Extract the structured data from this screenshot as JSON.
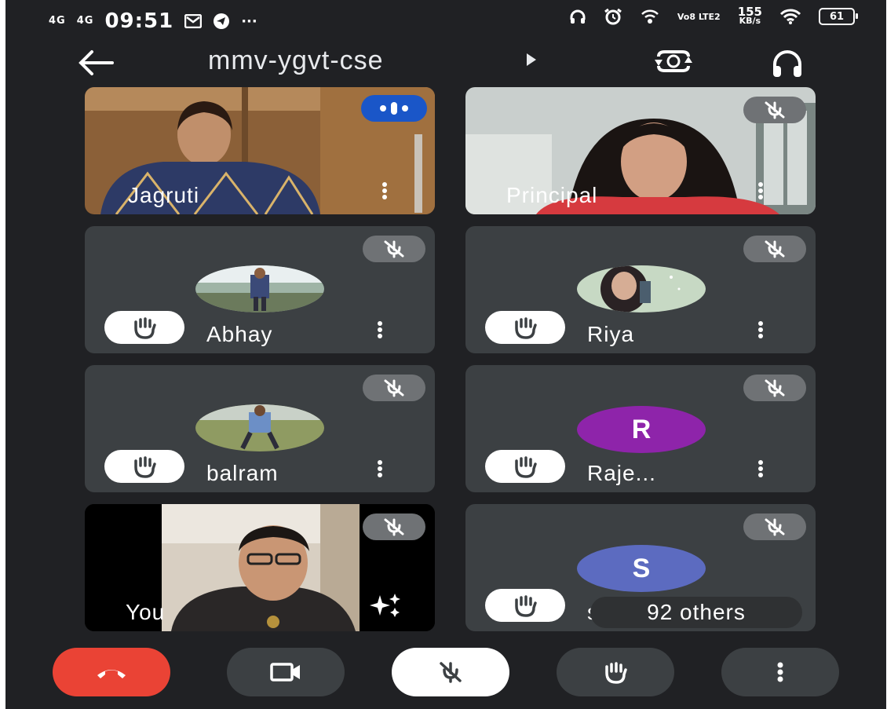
{
  "status_bar": {
    "network1": "4G",
    "network2": "4G",
    "time": "09:51",
    "more": "···",
    "volte": "Vo8 LTE2",
    "speed_value": "155",
    "speed_unit": "KB/s",
    "battery": "61"
  },
  "header": {
    "meeting_code": "mmv-ygvt-cse"
  },
  "participants": [
    {
      "name": "Jagruti",
      "speaking": true,
      "video": true
    },
    {
      "name": "Principal",
      "muted": true,
      "video": true
    },
    {
      "name": "Abhay",
      "muted": true,
      "hand_raised": true
    },
    {
      "name": "Riya",
      "muted": true,
      "hand_raised": true
    },
    {
      "name": "balram",
      "muted": true,
      "hand_raised": true
    },
    {
      "name": "Raje...",
      "muted": true,
      "hand_raised": true,
      "avatar_letter": "R",
      "avatar_color": "#8e24aa"
    },
    {
      "name": "You",
      "muted": true,
      "video": true
    },
    {
      "name": "su",
      "muted": true,
      "hand_raised": true,
      "avatar_letter": "S",
      "avatar_color": "#5c6bc0"
    }
  ],
  "others_label": "92 others",
  "controls": {
    "end_call_color": "#ea4335",
    "camera": "camera-icon",
    "mic": "mic-off-icon",
    "raise_hand": "hand-icon",
    "more": "more-vert-icon"
  }
}
